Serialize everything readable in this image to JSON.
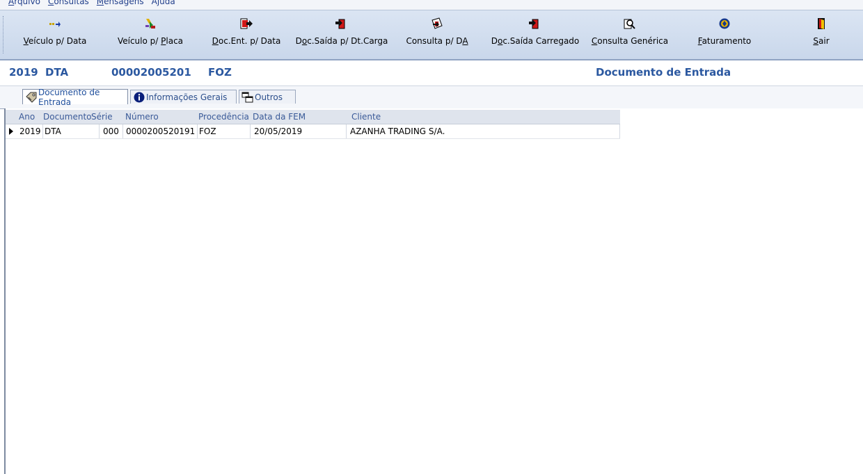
{
  "menu": {
    "items": [
      {
        "acc": "A",
        "rest": "rquivo"
      },
      {
        "acc": "C",
        "rest": "onsultas"
      },
      {
        "acc": "M",
        "rest": "ensagens"
      },
      {
        "acc": "",
        "rest": "Ajuda"
      }
    ]
  },
  "toolbar": {
    "buttons": [
      {
        "pre": "",
        "acc": "V",
        "post": "eículo p/ Data",
        "icon": "vehicle-date-icon"
      },
      {
        "pre": "Veículo p/ ",
        "acc": "P",
        "post": "laca",
        "icon": "vehicle-plate-icon"
      },
      {
        "pre": "",
        "acc": "D",
        "post": "oc.Ent. p/ Data",
        "icon": "doc-entry-date-icon"
      },
      {
        "pre": "D",
        "acc": "o",
        "post": "c.Saída p/ Dt.Carga",
        "icon": "doc-exit-load-date-icon"
      },
      {
        "pre": "Consulta p/ D",
        "acc": "A",
        "post": "",
        "icon": "query-da-icon"
      },
      {
        "pre": "D",
        "acc": "o",
        "post": "c.Saída Carregado",
        "icon": "doc-exit-loaded-icon"
      },
      {
        "pre": "",
        "acc": "C",
        "post": "onsulta Genérica",
        "icon": "generic-query-icon"
      },
      {
        "pre": "",
        "acc": "F",
        "post": "aturamento",
        "icon": "billing-icon"
      },
      {
        "pre": "",
        "acc": "S",
        "post": "air",
        "icon": "exit-door-icon"
      }
    ]
  },
  "header": {
    "year": "2019",
    "doc_type": "DTA",
    "number": "00002005201",
    "origin": "FOZ",
    "title": "Documento de Entrada"
  },
  "tabs": [
    {
      "label": "Documento de Entrada",
      "icon": "document-tag-icon",
      "active": true
    },
    {
      "label": "Informações Gerais",
      "icon": "info-icon",
      "active": false
    },
    {
      "label": "Outros",
      "icon": "windows-icon",
      "active": false
    }
  ],
  "grid": {
    "columns": [
      "Ano",
      "Documento",
      "Série",
      "Número",
      "Procedência",
      "Data da FEM",
      "Cliente"
    ],
    "rows": [
      [
        "2019",
        "DTA",
        "000",
        "0000200520191",
        "FOZ",
        "20/05/2019",
        "AZANHA TRADING S/A."
      ]
    ]
  },
  "colors": {
    "accent": "#2b58a0",
    "toolbar_bg": "#c9d7eb",
    "header_grid_bg": "#dfe4ed"
  }
}
